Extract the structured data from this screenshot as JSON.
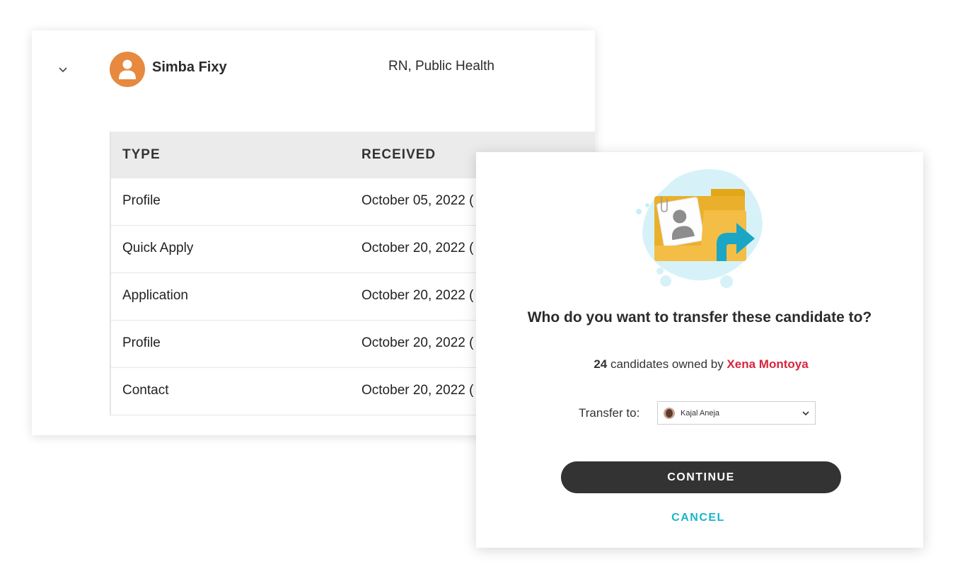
{
  "candidate": {
    "name": "Simba Fixy",
    "title": "RN, Public Health",
    "avatar_color": "#e7893f"
  },
  "table": {
    "headers": [
      "TYPE",
      "RECEIVED"
    ],
    "rows": [
      {
        "type": "Profile",
        "received": "October 05, 2022 ("
      },
      {
        "type": "Quick Apply",
        "received": "October 20, 2022 ("
      },
      {
        "type": "Application",
        "received": "October 20, 2022 ("
      },
      {
        "type": "Profile",
        "received": "October 20, 2022 ("
      },
      {
        "type": "Contact",
        "received": "October 20, 2022 ("
      }
    ]
  },
  "modal": {
    "question": "Who do you want to transfer these candidate to?",
    "count": "24",
    "owned_text": " candidates owned by ",
    "owner": "Xena Montoya",
    "transfer_label": "Transfer to:",
    "selected_user": "Kajal Aneja",
    "continue_label": "CONTINUE",
    "cancel_label": "CANCEL",
    "colors": {
      "accent": "#19b5c9",
      "owner": "#d7263d",
      "button": "#333333"
    }
  },
  "icons": {
    "expand": "chevron-down-icon",
    "avatar": "user-icon",
    "illustration": "folder-transfer-icon",
    "dropdown": "chevron-down-icon"
  }
}
